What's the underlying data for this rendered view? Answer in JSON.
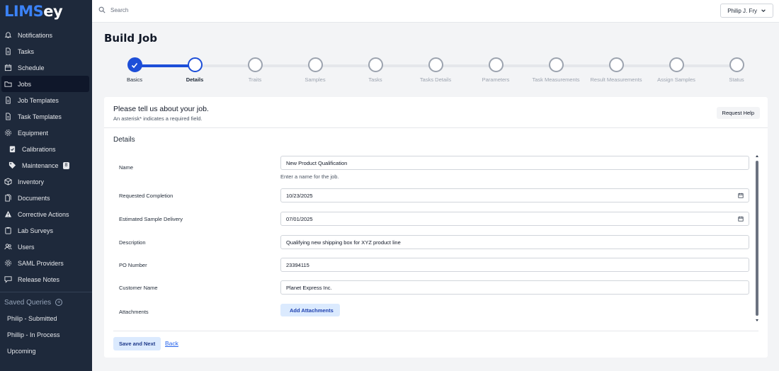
{
  "app": {
    "logo_primary": "LIMS",
    "logo_secondary": "ey",
    "brand_color": "#3b82f6"
  },
  "sidebar": {
    "items": [
      {
        "label": "Notifications",
        "icon": "bell-icon",
        "active": false
      },
      {
        "label": "Tasks",
        "icon": "document-icon",
        "active": false
      },
      {
        "label": "Schedule",
        "icon": "calendar-icon",
        "active": false
      },
      {
        "label": "Jobs",
        "icon": "folder-icon",
        "active": true
      },
      {
        "label": "Job Templates",
        "icon": "document-icon",
        "active": false
      },
      {
        "label": "Task Templates",
        "icon": "document-icon",
        "active": false
      },
      {
        "label": "Equipment",
        "icon": "gear-icon",
        "active": false
      },
      {
        "label": "Calibrations",
        "icon": "clipboard-check-icon",
        "active": false
      },
      {
        "label": "Maintenance",
        "icon": "tag-icon",
        "active": false,
        "badge": "8"
      },
      {
        "label": "Inventory",
        "icon": "box-icon",
        "active": false
      },
      {
        "label": "Documents",
        "icon": "documents-icon",
        "active": false
      },
      {
        "label": "Corrective Actions",
        "icon": "warning-icon",
        "active": false
      },
      {
        "label": "Lab Surveys",
        "icon": "clipboard-icon",
        "active": false
      },
      {
        "label": "Users",
        "icon": "users-icon",
        "active": false
      },
      {
        "label": "SAML Providers",
        "icon": "gear-icon",
        "active": false
      },
      {
        "label": "Release Notes",
        "icon": "chat-icon",
        "active": false
      }
    ],
    "saved_queries_label": "Saved Queries",
    "saved_queries": [
      "Philip - Submitted",
      "Phillip - In Process",
      "Upcoming"
    ]
  },
  "topbar": {
    "search_placeholder": "Search",
    "user_name": "Philip J. Fry"
  },
  "page": {
    "title": "Build Job"
  },
  "stepper": {
    "current_index": 1,
    "steps": [
      "Basics",
      "Details",
      "Traits",
      "Samples",
      "Tasks",
      "Tasks Details",
      "Parameters",
      "Task Measurements",
      "Result Measurements",
      "Assign Samples",
      "Status"
    ]
  },
  "card": {
    "title": "Please tell us about your job.",
    "subtitle": "An asterisk* indicates a required field.",
    "help_button": "Request Help",
    "section_title": "Details"
  },
  "form": {
    "name_label": "Name",
    "name_value": "New Product Qualification",
    "name_hint": "Enter a name for the job.",
    "requested_completion_label": "Requested Completion",
    "requested_completion_value": "10/23/2025",
    "estimated_delivery_label": "Estimated Sample Delivery",
    "estimated_delivery_value": "07/01/2025",
    "description_label": "Description",
    "description_value": "Qualifying new shipping box for XYZ product line",
    "po_number_label": "PO Number",
    "po_number_value": "23394115",
    "customer_name_label": "Customer Name",
    "customer_name_value": "Planet Express Inc.",
    "attachments_label": "Attachments",
    "add_attachments_button": "Add Attachments"
  },
  "footer": {
    "save_button": "Save and Next",
    "back_link": "Back"
  }
}
